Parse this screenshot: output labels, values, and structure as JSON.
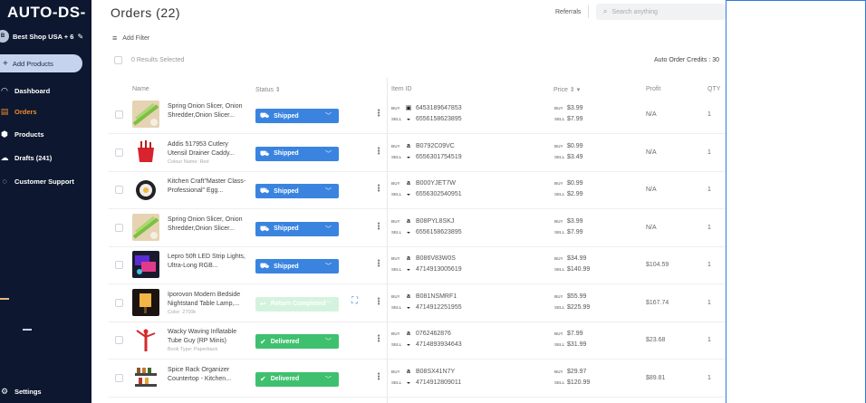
{
  "sidebar": {
    "logo": "AUTO-DS-",
    "shop": {
      "badge": "B",
      "label": "Best Shop USA + 6"
    },
    "add_products": "Add Products",
    "items": [
      {
        "label": "Dashboard",
        "icon": "gauge-icon"
      },
      {
        "label": "Orders",
        "icon": "orders-icon"
      },
      {
        "label": "Products",
        "icon": "box-icon"
      },
      {
        "label": "Drafts (241)",
        "icon": "cloud-icon"
      },
      {
        "label": "Customer Support",
        "icon": "support-icon"
      }
    ],
    "settings": "Settings"
  },
  "header": {
    "title": "Orders (22)",
    "referrals": "Referrals",
    "search_placeholder": "Search anything"
  },
  "toolbar": {
    "add_filter": "Add Filter",
    "results_selected": "0 Results Selected",
    "credits": "Auto Order Credits : 30"
  },
  "columns": {
    "name": "Name",
    "status": "Status",
    "item_id": "Item ID",
    "price": "Price",
    "profit": "Profit",
    "qty": "QTY"
  },
  "tags": {
    "buy": "BUY",
    "sell": "SELL"
  },
  "colors": {
    "sidebar_bg": "#0d1830",
    "active": "#f28a2a",
    "shipped": "#3a84e0",
    "delivered": "#3fc06f"
  },
  "orders": [
    {
      "name": "Spring Onion Slicer, Onion Shredder,Onion Slicer...",
      "meta": "",
      "status": "Shipped",
      "status_type": "shipped",
      "buy_id": "6453189647853",
      "sell_id": "6556158623895",
      "buy_price": "$3.99",
      "sell_price": "$7.99",
      "profit": "N/A",
      "qty": "1",
      "thumb": "onion",
      "buy_mark": "▣"
    },
    {
      "name": "Addis 517953 Cutlery Utensil Drainer Caddy...",
      "meta": "Colour Name: Red",
      "status": "Shipped",
      "status_type": "shipped",
      "buy_id": "B0792C09VC",
      "sell_id": "6556301754519",
      "buy_price": "$0.99",
      "sell_price": "$3.49",
      "profit": "N/A",
      "qty": "1",
      "thumb": "caddy",
      "buy_mark": "a"
    },
    {
      "name": "Kitchen Craft\"Master Class-Professional\" Egg...",
      "meta": "",
      "status": "Shipped",
      "status_type": "shipped",
      "buy_id": "B000YJET7W",
      "sell_id": "6556302540951",
      "buy_price": "$0.99",
      "sell_price": "$2.99",
      "profit": "N/A",
      "qty": "1",
      "thumb": "egg",
      "buy_mark": "a"
    },
    {
      "name": "Spring Onion Slicer, Onion Shredder,Onion Slicer...",
      "meta": "",
      "status": "Shipped",
      "status_type": "shipped",
      "buy_id": "B08PYL8SKJ",
      "sell_id": "6556158623895",
      "buy_price": "$3.99",
      "sell_price": "$7.99",
      "profit": "N/A",
      "qty": "1",
      "thumb": "onion",
      "buy_mark": "a"
    },
    {
      "name": "Lepro 50ft LED Strip Lights, Ultra-Long RGB...",
      "meta": "",
      "status": "Shipped",
      "status_type": "shipped",
      "buy_id": "B086V83W0S",
      "sell_id": "4714913005619",
      "buy_price": "$34.99",
      "sell_price": "$140.99",
      "profit": "$104.59",
      "qty": "1",
      "thumb": "led",
      "buy_mark": "a"
    },
    {
      "name": "Iporovon Modern Bedside Nightstand Table Lamp,...",
      "meta": "Color: 2700k",
      "status": "Return Completed",
      "status_type": "returned",
      "buy_id": "B081NSMRF1",
      "sell_id": "4714912251955",
      "buy_price": "$55.99",
      "sell_price": "$225.99",
      "profit": "$167.74",
      "qty": "1",
      "thumb": "lamp",
      "buy_mark": "a"
    },
    {
      "name": "Wacky Waving Inflatable Tube Guy (RP Minis)",
      "meta": "Book Type: Paperback",
      "status": "Delivered",
      "status_type": "delivered",
      "buy_id": "0762462876",
      "sell_id": "4714893934643",
      "buy_price": "$7.99",
      "sell_price": "$31.99",
      "profit": "$23.68",
      "qty": "1",
      "thumb": "tube",
      "buy_mark": "a"
    },
    {
      "name": "Spice Rack Organizer Countertop - Kitchen...",
      "meta": "",
      "status": "Delivered",
      "status_type": "delivered",
      "buy_id": "B08SX41N7Y",
      "sell_id": "4714912809011",
      "buy_price": "$29.97",
      "sell_price": "$120.99",
      "profit": "$89.81",
      "qty": "1",
      "thumb": "spice",
      "buy_mark": "a"
    }
  ]
}
